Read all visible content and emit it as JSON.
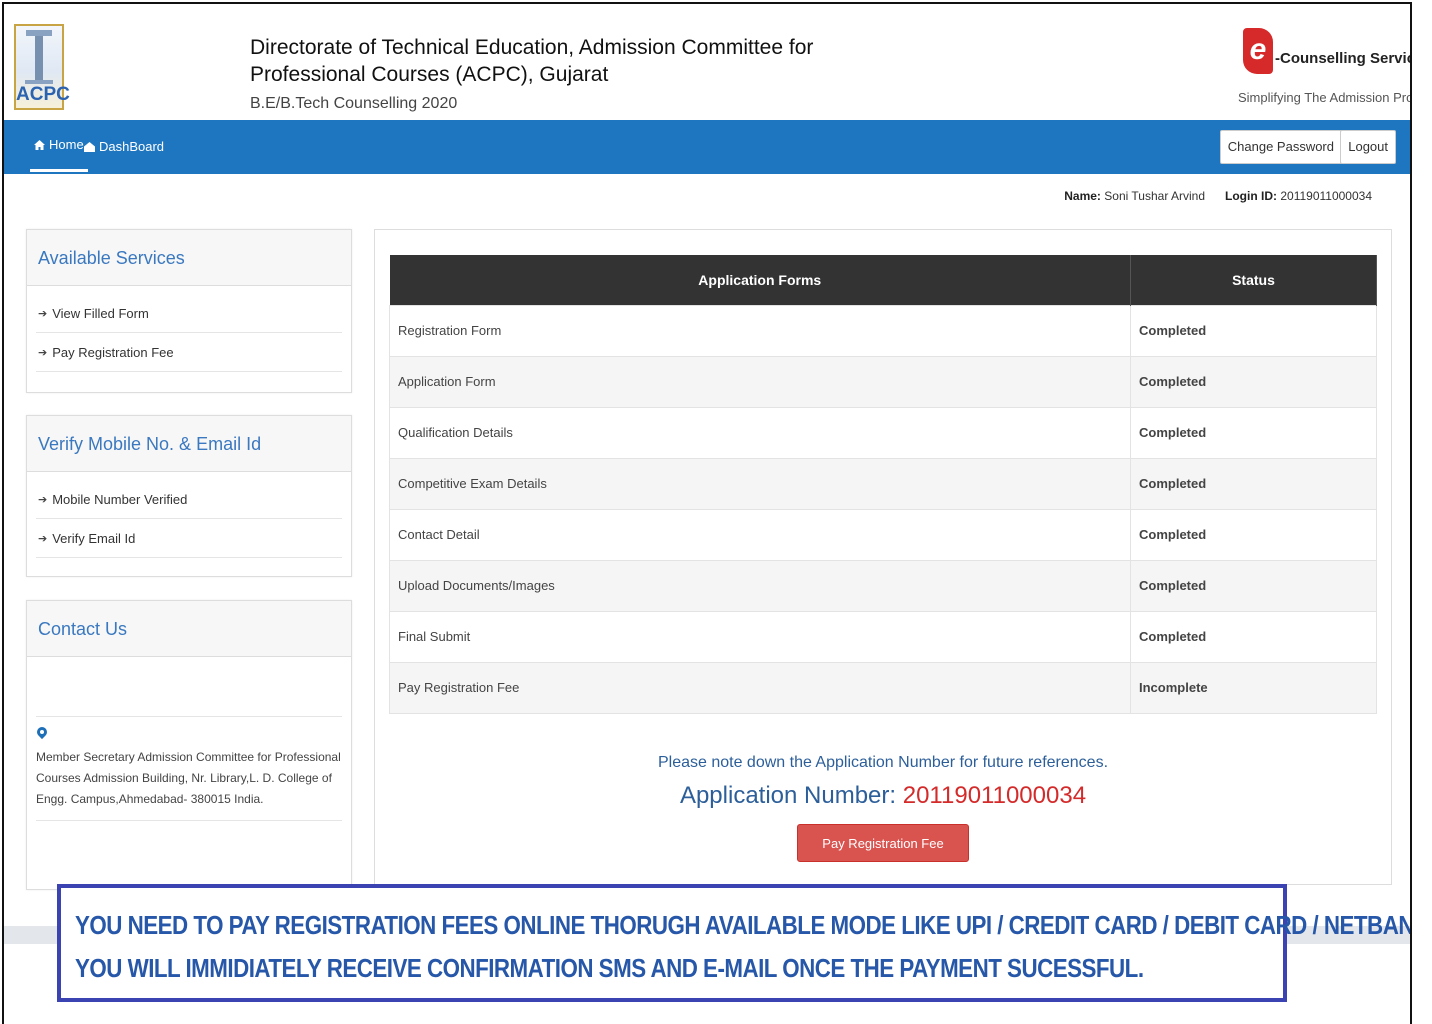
{
  "header": {
    "logo_text": "ACPC",
    "org_title": "Directorate of Technical Education, Admission Committee for Professional Courses (ACPC), Gujarat",
    "subtitle": "B.E/B.Tech Counselling 2020",
    "brand_mark": "e",
    "brand_name": "-Counselling Services",
    "brand_tagline": "Simplifying The Admission Process"
  },
  "navbar": {
    "home_label": "Home",
    "dashboard_label": "DashBoard",
    "change_password_label": "Change Password",
    "logout_label": "Logout"
  },
  "user": {
    "name_label": "Name:",
    "name_value": "Soni Tushar Arvind",
    "login_label": "Login ID:",
    "login_value": "20119011000034"
  },
  "sidebar": {
    "services": {
      "title": "Available Services",
      "items": [
        "View Filled Form",
        "Pay Registration Fee"
      ]
    },
    "verify": {
      "title": "Verify Mobile No. & Email Id",
      "items": [
        "Mobile Number Verified",
        "Verify Email Id"
      ]
    },
    "contact": {
      "title": "Contact Us",
      "address": "Member Secretary Admission Committee for Professional Courses Admission Building, Nr. Library,L. D. College of Engg. Campus,Ahmedabad- 380015 India."
    }
  },
  "table": {
    "headers": [
      "Application Forms",
      "Status"
    ],
    "rows": [
      {
        "form": "Registration Form",
        "status": "Completed"
      },
      {
        "form": "Application Form",
        "status": "Completed"
      },
      {
        "form": "Qualification Details",
        "status": "Completed"
      },
      {
        "form": "Competitive Exam Details",
        "status": "Completed"
      },
      {
        "form": "Contact Detail",
        "status": "Completed"
      },
      {
        "form": "Upload Documents/Images",
        "status": "Completed"
      },
      {
        "form": "Final Submit",
        "status": "Completed"
      },
      {
        "form": "Pay Registration Fee",
        "status": "Incomplete"
      }
    ]
  },
  "application": {
    "note": "Please note down the Application Number for future references.",
    "number_label": "Application Number:",
    "number_value": "20119011000034",
    "pay_button": "Pay Registration Fee"
  },
  "notice": {
    "line1": "YOU NEED TO PAY REGISTRATION FEES ONLINE THORUGH AVAILABLE MODE LIKE UPI / CREDIT CARD / DEBIT CARD / NETBANKING.",
    "line2": "YOU WILL IMMIDIATELY RECEIVE CONFIRMATION SMS AND E-MAIL ONCE THE PAYMENT SUCESSFUL."
  },
  "colors": {
    "navbar": "#1d76bf",
    "completed": "#3c8a3c",
    "incomplete": "#d22828",
    "notice_border": "#3b43b3",
    "pay_button": "#d9534f"
  }
}
